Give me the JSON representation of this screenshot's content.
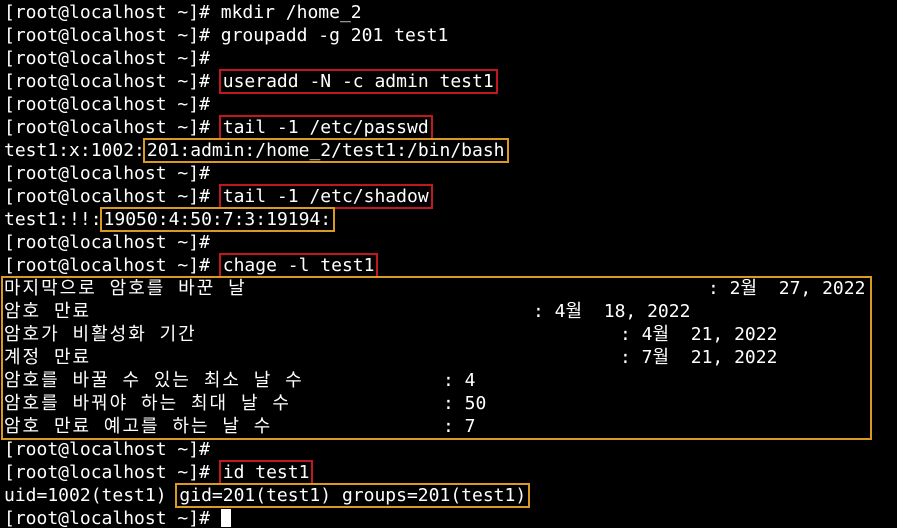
{
  "prompt": "[root@localhost ~]# ",
  "lines": [
    {
      "command": "mkdir /home_2"
    },
    {
      "command": "groupadd -g 201 test1"
    },
    {
      "command": ""
    },
    {
      "command": "useradd -N -c admin test1",
      "box": "red"
    },
    {
      "command": ""
    },
    {
      "command": "tail -1 /etc/passwd",
      "box": "red"
    },
    {
      "output": "test1:x:1002:",
      "boxed_output": "201:admin:/home_2/test1:/bin/bash"
    },
    {
      "command": ""
    },
    {
      "command": "tail -1 /etc/shadow",
      "box": "red"
    },
    {
      "output": "test1:!!:",
      "boxed_output": "19050:4:50:7:3:19194:"
    },
    {
      "command": ""
    },
    {
      "command": "chage -l test1",
      "box": "red"
    }
  ],
  "chage": [
    {
      "label": "마지막으로 암호를 바꾼 날",
      "value": ": 2월  27, 2022"
    },
    {
      "label": "암호 만료",
      "value": ": 4월  18, 2022"
    },
    {
      "label": "암호가 비활성화 기간",
      "value": ": 4월  21, 2022"
    },
    {
      "label": "계정 만료",
      "value": ": 7월  21, 2022"
    },
    {
      "label": "암호를 바꿀 수 있는 최소 날 수",
      "value": ": 4"
    },
    {
      "label": "암호를 바꿔야 하는 최대 날 수",
      "value": ": 50"
    },
    {
      "label": "암호 만료 예고를 하는 날 수",
      "value": ": 7"
    }
  ],
  "after": [
    {
      "command": ""
    },
    {
      "command": "id test1",
      "box": "red"
    },
    {
      "output": "uid=1002(test1) ",
      "boxed_output": "gid=201(test1) groups=201(test1)"
    },
    {
      "command": "",
      "cursor": true
    }
  ]
}
